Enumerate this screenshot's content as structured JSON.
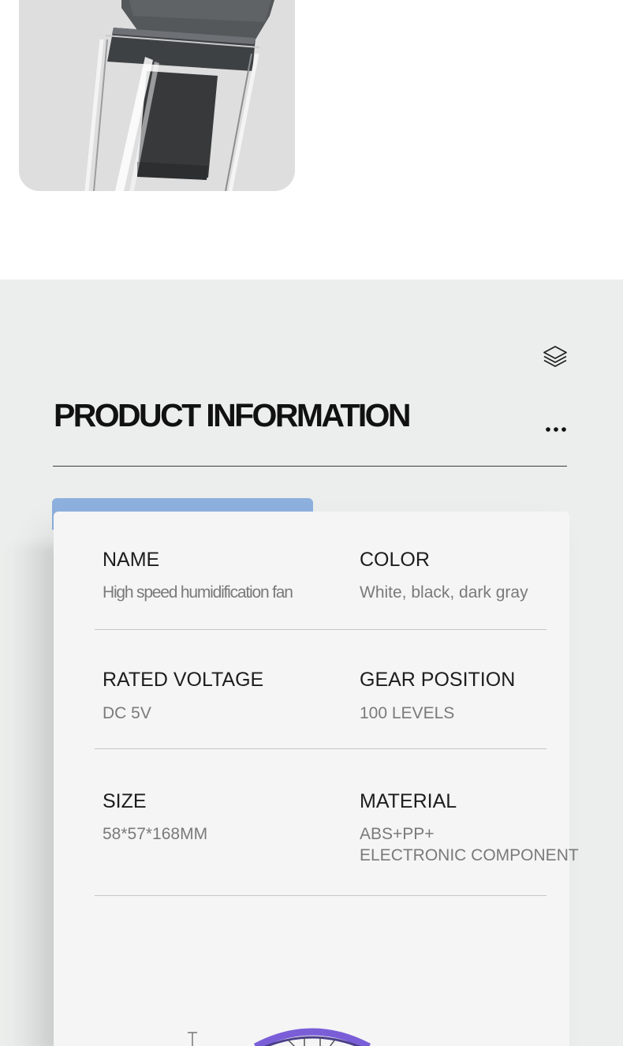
{
  "section": {
    "title": "PRODUCT INFORMATION",
    "icons": {
      "header": "layers-icon",
      "more": "more-dots-icon"
    },
    "colors": {
      "accent": "#8db0de",
      "background": "#eceeed",
      "card": "#f5f5f5"
    }
  },
  "specs": {
    "name": {
      "label": "NAME",
      "value": "High speed humidification fan"
    },
    "color": {
      "label": "COLOR",
      "value": "White, black, dark gray"
    },
    "voltage": {
      "label": "RATED VOLTAGE",
      "value": "DC 5V"
    },
    "gear": {
      "label": "GEAR POSITION",
      "value": "100 LEVELS"
    },
    "size": {
      "label": "SIZE",
      "value": "58*57*168MM"
    },
    "material": {
      "label": "MATERIAL",
      "value_line1": "ABS+PP+",
      "value_line2": "ELECTRONIC COMPONENT"
    }
  }
}
